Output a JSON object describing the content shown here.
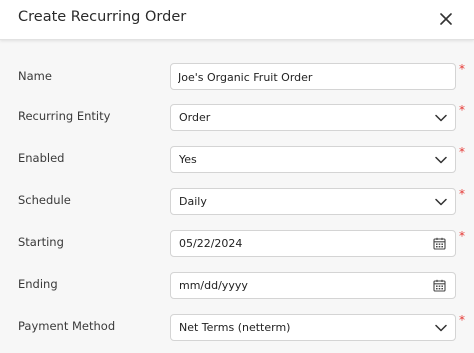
{
  "dialog": {
    "title": "Create Recurring Order",
    "close_icon": "close-icon"
  },
  "form": {
    "name": {
      "label": "Name",
      "value": "Joe's Organic Fruit Order",
      "required": true
    },
    "recurring_entity": {
      "label": "Recurring Entity",
      "value": "Order",
      "required": true
    },
    "enabled": {
      "label": "Enabled",
      "value": "Yes",
      "required": true
    },
    "schedule": {
      "label": "Schedule",
      "value": "Daily",
      "required": true
    },
    "starting": {
      "label": "Starting",
      "value": "05/22/2024",
      "required": true
    },
    "ending": {
      "label": "Ending",
      "value": "mm/dd/yyyy",
      "required": false
    },
    "payment_method": {
      "label": "Payment Method",
      "value": "Net Terms (netterm)",
      "required": true
    },
    "required_marker": "*"
  },
  "colors": {
    "required": "#e53935",
    "background": "#f7f7f7",
    "field_border": "#d4d4d4"
  },
  "icons": [
    "close-icon",
    "chevron-down-icon",
    "calendar-icon"
  ]
}
